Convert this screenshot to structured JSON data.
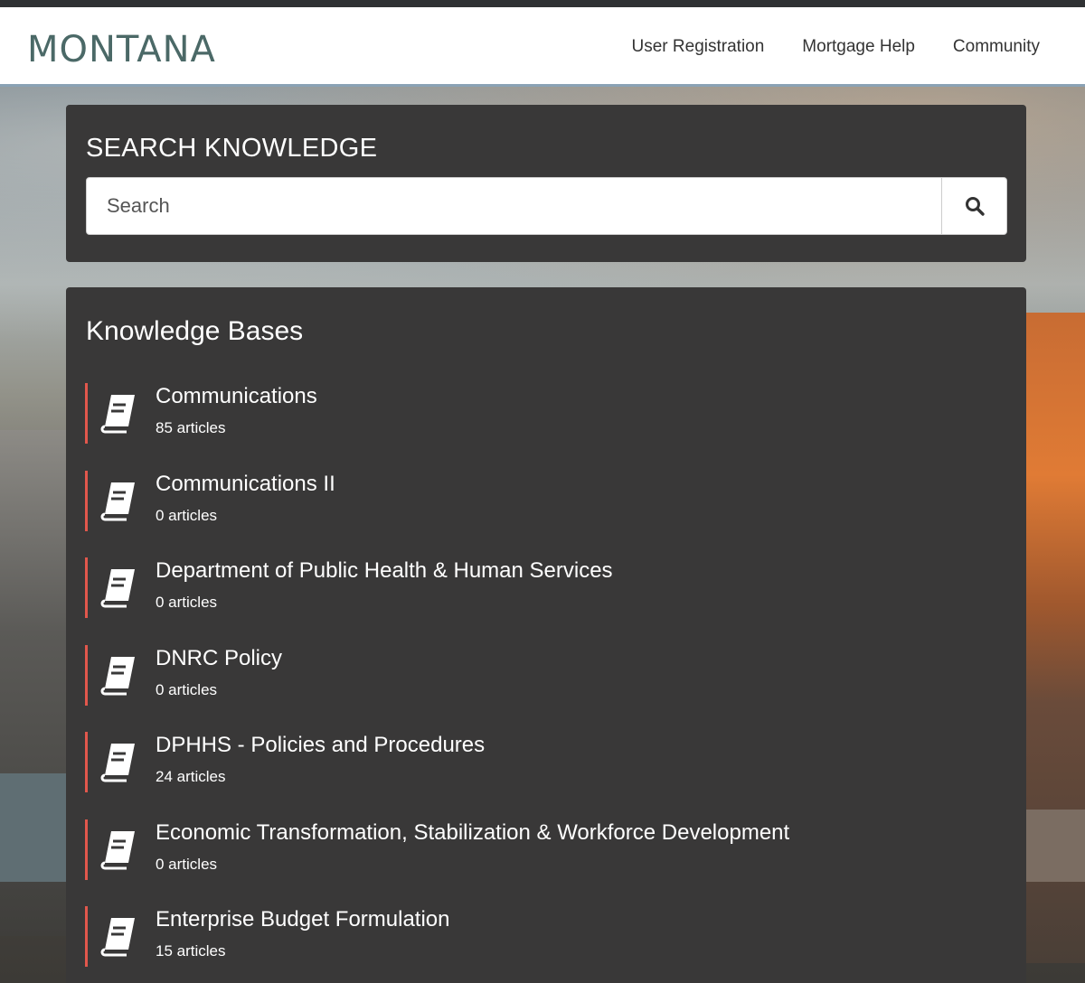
{
  "header": {
    "brand": "MONTANA",
    "nav": [
      {
        "label": "User Registration"
      },
      {
        "label": "Mortgage Help"
      },
      {
        "label": "Community"
      }
    ]
  },
  "search": {
    "title": "SEARCH KNOWLEDGE",
    "placeholder": "Search",
    "button_icon": "search-icon"
  },
  "knowledge_bases": {
    "title": "Knowledge Bases",
    "icon": "book-icon",
    "accent_color": "#e2574c",
    "items": [
      {
        "name": "Communications",
        "count": "85 articles"
      },
      {
        "name": "Communications II",
        "count": "0 articles"
      },
      {
        "name": "Department of Public Health & Human Services",
        "count": "0 articles"
      },
      {
        "name": "DNRC Policy",
        "count": "0 articles"
      },
      {
        "name": "DPHHS - Policies and Procedures",
        "count": "24 articles"
      },
      {
        "name": "Economic Transformation, Stabilization & Workforce Development",
        "count": "0 articles"
      },
      {
        "name": "Enterprise Budget Formulation",
        "count": "15 articles"
      }
    ]
  },
  "colors": {
    "panel_bg": "#393838",
    "brand": "#4b6967"
  }
}
